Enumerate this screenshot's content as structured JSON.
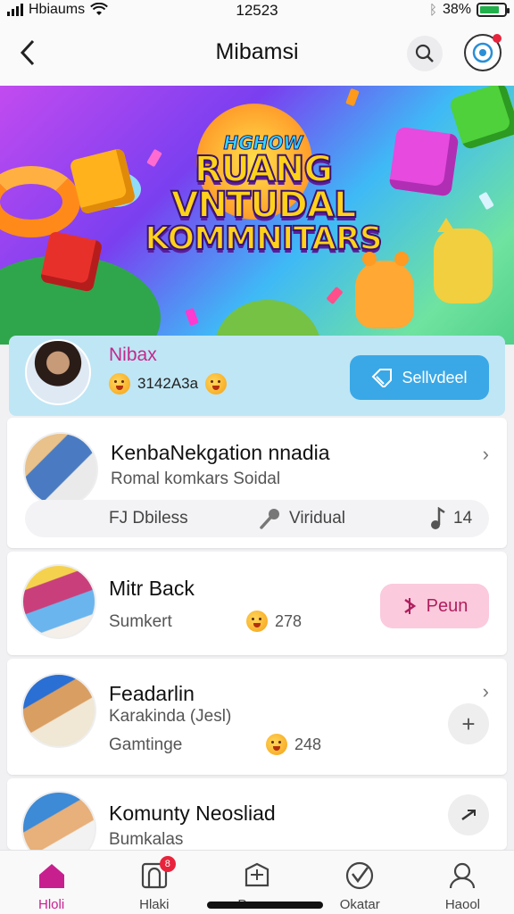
{
  "status_bar": {
    "carrier": "Hbiaums",
    "time": "12523",
    "battery_percent": "38%",
    "battery_level": 0.8
  },
  "header": {
    "title": "Mibamsi"
  },
  "banner": {
    "small": "HGHOW",
    "line1": "RUANG",
    "line2": "VNTUDAL",
    "line3": "KOMMNITARS"
  },
  "user_card": {
    "name": "Nibax",
    "meta": "3142A3a",
    "button_label": "Sellvdeel"
  },
  "cards": [
    {
      "name": "KenbaNekgation nnadia",
      "sub": "Romal komkars Soidal",
      "stats": [
        {
          "label": "FJ Dbiless"
        },
        {
          "label": "Viridual"
        },
        {
          "label": "14"
        }
      ]
    },
    {
      "name": "Mitr Back",
      "sub": "Sumkert",
      "count": "278",
      "button_label": "Peun"
    },
    {
      "name": "Feadarlin",
      "sub": "Karakinda (Jesl)",
      "sub2": "Gamtinge",
      "count": "248"
    },
    {
      "name": "Komunty Neosliad",
      "sub": "Bumkalas"
    }
  ],
  "tabs": [
    {
      "label": "Hloli",
      "icon": "home-icon",
      "active": true
    },
    {
      "label": "Hlaki",
      "icon": "inbox-icon",
      "badge": "8"
    },
    {
      "label": "Pnonn",
      "icon": "box-icon"
    },
    {
      "label": "Okatar",
      "icon": "check-icon"
    },
    {
      "label": "Haool",
      "icon": "profile-icon"
    }
  ],
  "colors": {
    "accent": "#c81f8f",
    "select_button": "#3aa8e6",
    "pin_button": "#fbcadd"
  }
}
